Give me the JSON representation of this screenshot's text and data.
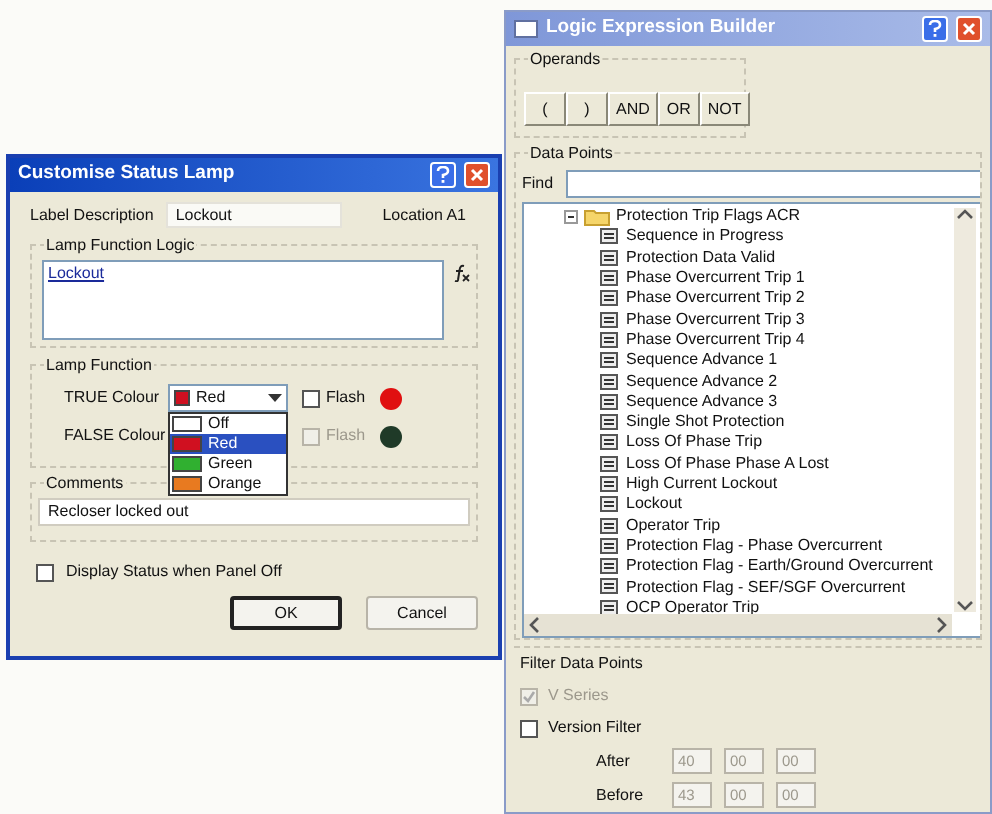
{
  "builder": {
    "title": "Logic Expression Builder",
    "operands": {
      "title": "Operands",
      "buttons": [
        "(",
        ")",
        "AND",
        "OR",
        "NOT"
      ]
    },
    "data_points": {
      "title": "Data Points",
      "find_label": "Find",
      "tree": {
        "label": "Protection Trip Flags ACR",
        "expanded": true,
        "children": [
          {
            "label": "Sequence in Progress"
          },
          {
            "label": "Protection Data Valid"
          },
          {
            "label": "Phase Overcurrent Trip 1"
          },
          {
            "label": "Phase Overcurrent Trip 2"
          },
          {
            "label": "Phase Overcurrent Trip 3"
          },
          {
            "label": "Phase Overcurrent Trip 4"
          },
          {
            "label": "Sequence Advance 1"
          },
          {
            "label": "Sequence Advance 2"
          },
          {
            "label": "Sequence Advance 3"
          },
          {
            "label": "Single Shot Protection"
          },
          {
            "label": "Loss Of Phase Trip"
          },
          {
            "label": "Loss Of Phase Phase A Lost"
          },
          {
            "label": "High Current Lockout"
          },
          {
            "label": "Lockout"
          },
          {
            "label": "Operator Trip"
          },
          {
            "label": "Protection Flag - Phase Overcurrent"
          },
          {
            "label": "Protection Flag - Earth/Ground Overcurrent"
          },
          {
            "label": "Protection Flag - SEF/SGF Overcurrent"
          },
          {
            "label": "OCP Operator Trip"
          }
        ]
      }
    },
    "filter": {
      "title": "Filter Data Points",
      "v_series": {
        "label": "V Series",
        "checked": true,
        "disabled": true
      },
      "version_filter": {
        "label": "Version Filter",
        "checked": false
      },
      "ranges": [
        {
          "label": "After",
          "values": [
            "40",
            "00",
            "00"
          ]
        },
        {
          "label": "Before",
          "values": [
            "43",
            "00",
            "00"
          ]
        }
      ]
    }
  },
  "dialog": {
    "title": "Customise Status Lamp",
    "label_description": {
      "label": "Label Description",
      "value": "Lockout"
    },
    "location": "Location A1",
    "logic": {
      "title": "Lamp Function Logic",
      "value": "Lockout"
    },
    "lamp_function": {
      "title": "Lamp Function",
      "rows": [
        {
          "label": "TRUE Colour",
          "value": "Red",
          "flash_label": "Flash",
          "flash_checked": false,
          "flash_disabled": false,
          "color": "#e01010"
        },
        {
          "label": "FALSE Colour",
          "flash_label": "Flash",
          "flash_checked": false,
          "flash_disabled": true,
          "color": "#1f3a28"
        }
      ]
    },
    "dropdown": [
      {
        "label": "Off",
        "color": "#ffffff",
        "selected": false
      },
      {
        "label": "Red",
        "color": "#d01020",
        "selected": true
      },
      {
        "label": "Green",
        "color": "#30b030",
        "selected": false
      },
      {
        "label": "Orange",
        "color": "#e87a20",
        "selected": false
      }
    ],
    "comments": {
      "title": "Comments",
      "value": "Recloser locked out"
    },
    "display_status": {
      "label": "Display Status when Panel Off",
      "checked": false
    },
    "buttons": [
      {
        "label": "OK",
        "default": true
      },
      {
        "label": "Cancel",
        "default": false
      }
    ]
  }
}
